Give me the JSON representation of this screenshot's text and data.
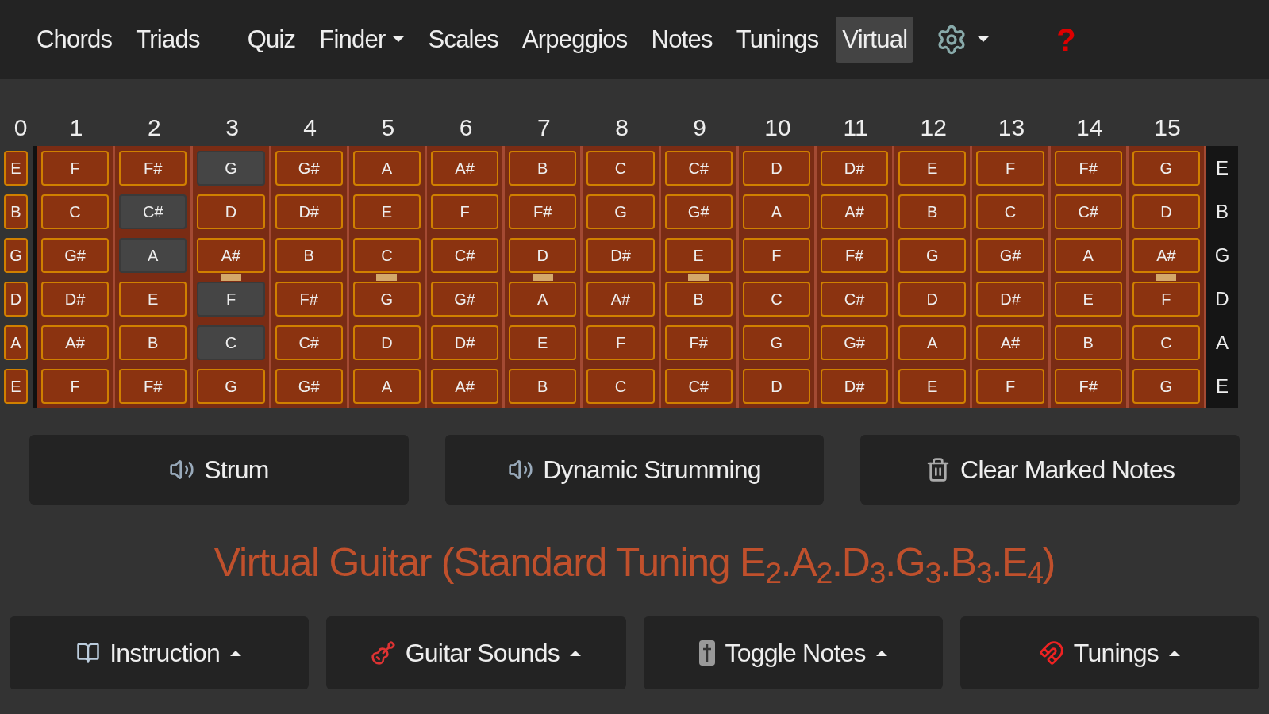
{
  "nav": {
    "items": [
      {
        "label": "Chords",
        "kind": "link",
        "selected": false
      },
      {
        "label": "Triads",
        "kind": "link",
        "selected": false
      },
      {
        "label": "Quiz",
        "kind": "link",
        "selected": false
      },
      {
        "label": "Finder",
        "kind": "dropdown",
        "selected": false
      },
      {
        "label": "Scales",
        "kind": "link",
        "selected": false
      },
      {
        "label": "Arpeggios",
        "kind": "link",
        "selected": false
      },
      {
        "label": "Notes",
        "kind": "link",
        "selected": false
      },
      {
        "label": "Tunings",
        "kind": "link",
        "selected": false
      },
      {
        "label": "Virtual",
        "kind": "link",
        "selected": true
      }
    ],
    "help": "?"
  },
  "frets": [
    {
      "label": "0"
    },
    {
      "label": "1"
    },
    {
      "label": "2"
    },
    {
      "label": "3",
      "marker": true
    },
    {
      "label": "4"
    },
    {
      "label": "5",
      "marker": true
    },
    {
      "label": "6"
    },
    {
      "label": "7",
      "marker": true
    },
    {
      "label": "8"
    },
    {
      "label": "9",
      "marker": true
    },
    {
      "label": "10"
    },
    {
      "label": "11"
    },
    {
      "label": "12"
    },
    {
      "label": "13"
    },
    {
      "label": "14"
    },
    {
      "label": "15",
      "marker": true
    }
  ],
  "strings": [
    {
      "open": "E",
      "end": "E",
      "notes": [
        {
          "note": "F",
          "selected": false
        },
        {
          "note": "F#",
          "selected": false
        },
        {
          "note": "G",
          "selected": true
        },
        {
          "note": "G#",
          "selected": false
        },
        {
          "note": "A",
          "selected": false
        },
        {
          "note": "A#",
          "selected": false
        },
        {
          "note": "B",
          "selected": false
        },
        {
          "note": "C",
          "selected": false
        },
        {
          "note": "C#",
          "selected": false
        },
        {
          "note": "D",
          "selected": false
        },
        {
          "note": "D#",
          "selected": false
        },
        {
          "note": "E",
          "selected": false
        },
        {
          "note": "F",
          "selected": false
        },
        {
          "note": "F#",
          "selected": false
        },
        {
          "note": "G",
          "selected": false
        }
      ]
    },
    {
      "open": "B",
      "end": "B",
      "notes": [
        {
          "note": "C",
          "selected": false
        },
        {
          "note": "C#",
          "selected": true
        },
        {
          "note": "D",
          "selected": false
        },
        {
          "note": "D#",
          "selected": false
        },
        {
          "note": "E",
          "selected": false
        },
        {
          "note": "F",
          "selected": false
        },
        {
          "note": "F#",
          "selected": false
        },
        {
          "note": "G",
          "selected": false
        },
        {
          "note": "G#",
          "selected": false
        },
        {
          "note": "A",
          "selected": false
        },
        {
          "note": "A#",
          "selected": false
        },
        {
          "note": "B",
          "selected": false
        },
        {
          "note": "C",
          "selected": false
        },
        {
          "note": "C#",
          "selected": false
        },
        {
          "note": "D",
          "selected": false
        }
      ]
    },
    {
      "open": "G",
      "end": "G",
      "notes": [
        {
          "note": "G#",
          "selected": false
        },
        {
          "note": "A",
          "selected": true
        },
        {
          "note": "A#",
          "selected": false
        },
        {
          "note": "B",
          "selected": false
        },
        {
          "note": "C",
          "selected": false
        },
        {
          "note": "C#",
          "selected": false
        },
        {
          "note": "D",
          "selected": false
        },
        {
          "note": "D#",
          "selected": false
        },
        {
          "note": "E",
          "selected": false
        },
        {
          "note": "F",
          "selected": false
        },
        {
          "note": "F#",
          "selected": false
        },
        {
          "note": "G",
          "selected": false
        },
        {
          "note": "G#",
          "selected": false
        },
        {
          "note": "A",
          "selected": false
        },
        {
          "note": "A#",
          "selected": false
        }
      ]
    },
    {
      "open": "D",
      "end": "D",
      "notes": [
        {
          "note": "D#",
          "selected": false
        },
        {
          "note": "E",
          "selected": false
        },
        {
          "note": "F",
          "selected": true
        },
        {
          "note": "F#",
          "selected": false
        },
        {
          "note": "G",
          "selected": false
        },
        {
          "note": "G#",
          "selected": false
        },
        {
          "note": "A",
          "selected": false
        },
        {
          "note": "A#",
          "selected": false
        },
        {
          "note": "B",
          "selected": false
        },
        {
          "note": "C",
          "selected": false
        },
        {
          "note": "C#",
          "selected": false
        },
        {
          "note": "D",
          "selected": false
        },
        {
          "note": "D#",
          "selected": false
        },
        {
          "note": "E",
          "selected": false
        },
        {
          "note": "F",
          "selected": false
        }
      ]
    },
    {
      "open": "A",
      "end": "A",
      "notes": [
        {
          "note": "A#",
          "selected": false
        },
        {
          "note": "B",
          "selected": false
        },
        {
          "note": "C",
          "selected": true
        },
        {
          "note": "C#",
          "selected": false
        },
        {
          "note": "D",
          "selected": false
        },
        {
          "note": "D#",
          "selected": false
        },
        {
          "note": "E",
          "selected": false
        },
        {
          "note": "F",
          "selected": false
        },
        {
          "note": "F#",
          "selected": false
        },
        {
          "note": "G",
          "selected": false
        },
        {
          "note": "G#",
          "selected": false
        },
        {
          "note": "A",
          "selected": false
        },
        {
          "note": "A#",
          "selected": false
        },
        {
          "note": "B",
          "selected": false
        },
        {
          "note": "C",
          "selected": false
        }
      ]
    },
    {
      "open": "E",
      "end": "E",
      "notes": [
        {
          "note": "F",
          "selected": false
        },
        {
          "note": "F#",
          "selected": false
        },
        {
          "note": "G",
          "selected": false
        },
        {
          "note": "G#",
          "selected": false
        },
        {
          "note": "A",
          "selected": false
        },
        {
          "note": "A#",
          "selected": false
        },
        {
          "note": "B",
          "selected": false
        },
        {
          "note": "C",
          "selected": false
        },
        {
          "note": "C#",
          "selected": false
        },
        {
          "note": "D",
          "selected": false
        },
        {
          "note": "D#",
          "selected": false
        },
        {
          "note": "E",
          "selected": false
        },
        {
          "note": "F",
          "selected": false
        },
        {
          "note": "F#",
          "selected": false
        },
        {
          "note": "G",
          "selected": false
        }
      ]
    }
  ],
  "actions": [
    {
      "label": "Strum",
      "kind": "speaker"
    },
    {
      "label": "Dynamic Strumming",
      "kind": "speaker"
    },
    {
      "label": "Clear Marked Notes",
      "kind": "trash"
    }
  ],
  "title": "Virtual Guitar (Standard Tuning E$_{2}$.A$_{2}$.D$_{3}$.G$_{3}$.B$_{3}$.E$_{4}$)",
  "panels": [
    {
      "label": "Instruction",
      "kind": "book"
    },
    {
      "label": "Guitar Sounds",
      "kind": "guitar"
    },
    {
      "label": "Toggle Notes",
      "kind": "tag"
    },
    {
      "label": "Tunings",
      "kind": "magnet"
    }
  ]
}
